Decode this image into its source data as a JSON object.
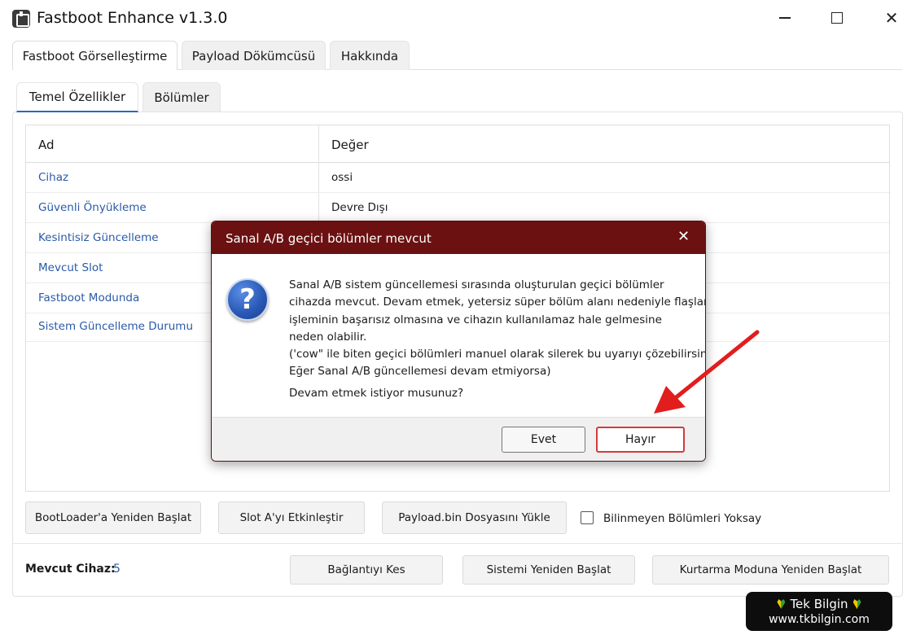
{
  "window": {
    "title": "Fastboot Enhance v1.3.0",
    "minimize": "—",
    "maximize": "□",
    "close": "✕"
  },
  "tabs": [
    {
      "label": "Fastboot Görselleştirme",
      "active": true
    },
    {
      "label": "Payload Dökümcüsü",
      "active": false
    },
    {
      "label": "Hakkında",
      "active": false
    }
  ],
  "subtabs": [
    {
      "label": "Temel Özellikler",
      "active": true
    },
    {
      "label": "Bölümler",
      "active": false
    }
  ],
  "grid": {
    "columns": [
      "Ad",
      "Değer"
    ],
    "rows": [
      {
        "name": "Cihaz",
        "value": "ossi"
      },
      {
        "name": "Güvenli Önyükleme",
        "value": "Devre Dışı"
      },
      {
        "name": "Kesintisiz Güncelleme",
        "value": ""
      },
      {
        "name": "Mevcut Slot",
        "value": ""
      },
      {
        "name": "Fastboot Modunda",
        "value": ""
      },
      {
        "name": "Sistem Güncelleme Durumu",
        "value": ""
      }
    ]
  },
  "actions": {
    "reboot_bootloader": "BootLoader'a Yeniden Başlat",
    "activate_slot_a": "Slot A'yı Etkinleştir",
    "load_payload": "Payload.bin Dosyasını Yükle",
    "ignore_unknown": "Bilinmeyen Bölümleri Yoksay",
    "ignore_unknown_checked": false,
    "disconnect": "Bağlantıyı Kes",
    "reboot_system": "Sistemi Yeniden Başlat",
    "reboot_recovery": "Kurtarma Moduna Yeniden Başlat"
  },
  "device": {
    "label": "Mevcut Cihaz:",
    "value": "5"
  },
  "dialog": {
    "title": "Sanal A/B geçici bölümler mevcut",
    "close": "✕",
    "icon": "question-icon",
    "icon_glyph": "?",
    "message_lines": [
      "Sanal A/B sistem güncellemesi sırasında oluşturulan geçici bölümler",
      "cihazda mevcut. Devam etmek, yetersiz süper bölüm alanı nedeniyle flaşlama",
      "işleminin başarısız olmasına ve cihazın kullanılamaz hale gelmesine",
      "neden olabilir.",
      "('cow\" ile biten geçici bölümleri manuel olarak silerek bu uyarıyı çözebilirsiniz.",
      "Eğer Sanal A/B güncellemesi devam etmiyorsa)"
    ],
    "question": "Devam etmek istiyor musunuz?",
    "yes": "Evet",
    "no": "Hayır"
  },
  "watermark": {
    "line1": "Tek Bilgin",
    "line2": "www.tkbilgin.com"
  },
  "colors": {
    "dialog_title_bg": "#6b1112",
    "link_text": "#2a5aa8",
    "accent_tab": "#2a66c9",
    "annotation_arrow": "#e21d1d"
  }
}
